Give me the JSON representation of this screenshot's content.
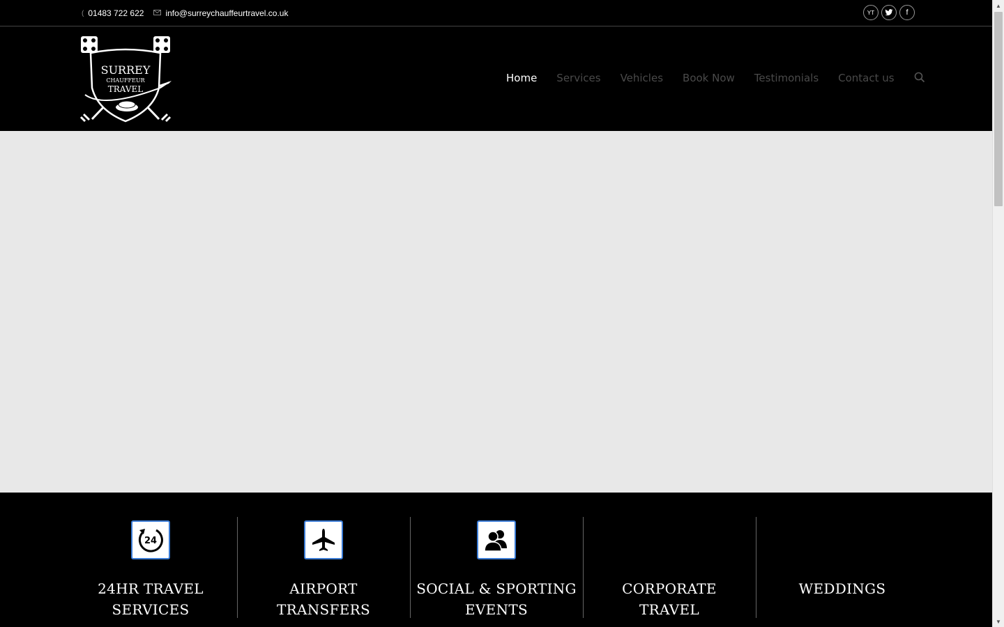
{
  "topbar": {
    "phone": "01483 722 622",
    "email": "info@surreychauffeurtravel.co.uk",
    "social": [
      {
        "label": "YT",
        "name": "youtube"
      },
      {
        "label": "t",
        "name": "twitter"
      },
      {
        "label": "f",
        "name": "facebook"
      }
    ]
  },
  "logo": {
    "line1": "SURREY",
    "line2": "CHAUFFEUR",
    "line3": "TRAVEL"
  },
  "nav": {
    "items": [
      "Home",
      "Services",
      "Vehicles",
      "Book Now",
      "Testimonials",
      "Contact us"
    ],
    "active": "Home"
  },
  "services": [
    {
      "title_line1": "24HR TRAVEL",
      "title_line2": "SERVICES",
      "icon": "24hr-icon"
    },
    {
      "title_line1": "AIRPORT",
      "title_line2": "TRANSFERS",
      "icon": "airplane-icon"
    },
    {
      "title_line1": "SOCIAL & SPORTING",
      "title_line2": "EVENTS",
      "icon": "people-icon"
    },
    {
      "title_line1": "CORPORATE",
      "title_line2": "TRAVEL",
      "icon": ""
    },
    {
      "title_line1": "WEDDINGS",
      "title_line2": "",
      "icon": ""
    }
  ],
  "colors": {
    "header_bg": "#000000",
    "hero_bg": "#e8e8e8",
    "icon_border": "#3a7bd5",
    "nav_active": "#ffffff",
    "nav_inactive": "#4a4a4a"
  }
}
